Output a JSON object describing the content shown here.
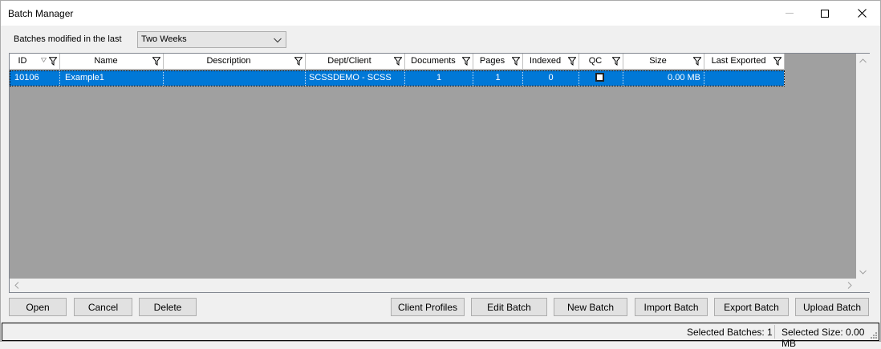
{
  "window": {
    "title": "Batch Manager"
  },
  "filter": {
    "label": "Batches modified in the last",
    "selected": "Two Weeks"
  },
  "grid": {
    "columns": [
      {
        "key": "id",
        "label": "ID"
      },
      {
        "key": "name",
        "label": "Name"
      },
      {
        "key": "description",
        "label": "Description"
      },
      {
        "key": "dept_client",
        "label": "Dept/Client"
      },
      {
        "key": "documents",
        "label": "Documents"
      },
      {
        "key": "pages",
        "label": "Pages"
      },
      {
        "key": "indexed",
        "label": "Indexed"
      },
      {
        "key": "qc",
        "label": "QC"
      },
      {
        "key": "size",
        "label": "Size"
      },
      {
        "key": "last_exported",
        "label": "Last Exported"
      }
    ],
    "rows": [
      {
        "id": "10106",
        "name": "Example1",
        "description": "",
        "dept_client": "SCSSDEMO - SCSS",
        "documents": "1",
        "pages": "1",
        "indexed": "0",
        "qc": false,
        "size": "0.00 MB",
        "last_exported": "",
        "selected": true
      }
    ]
  },
  "buttons": {
    "open": "Open",
    "cancel": "Cancel",
    "delete": "Delete",
    "client_profiles": "Client Profiles",
    "edit_batch": "Edit Batch",
    "new_batch": "New Batch",
    "import_batch": "Import Batch",
    "export_batch": "Export Batch",
    "upload_batch": "Upload Batch"
  },
  "status": {
    "selected_batches": "Selected Batches: 1",
    "selected_size": "Selected Size: 0.00 MB"
  },
  "colors": {
    "selection": "#0078d7",
    "grid_background": "#a0a0a0",
    "button_face": "#e1e1e1"
  }
}
